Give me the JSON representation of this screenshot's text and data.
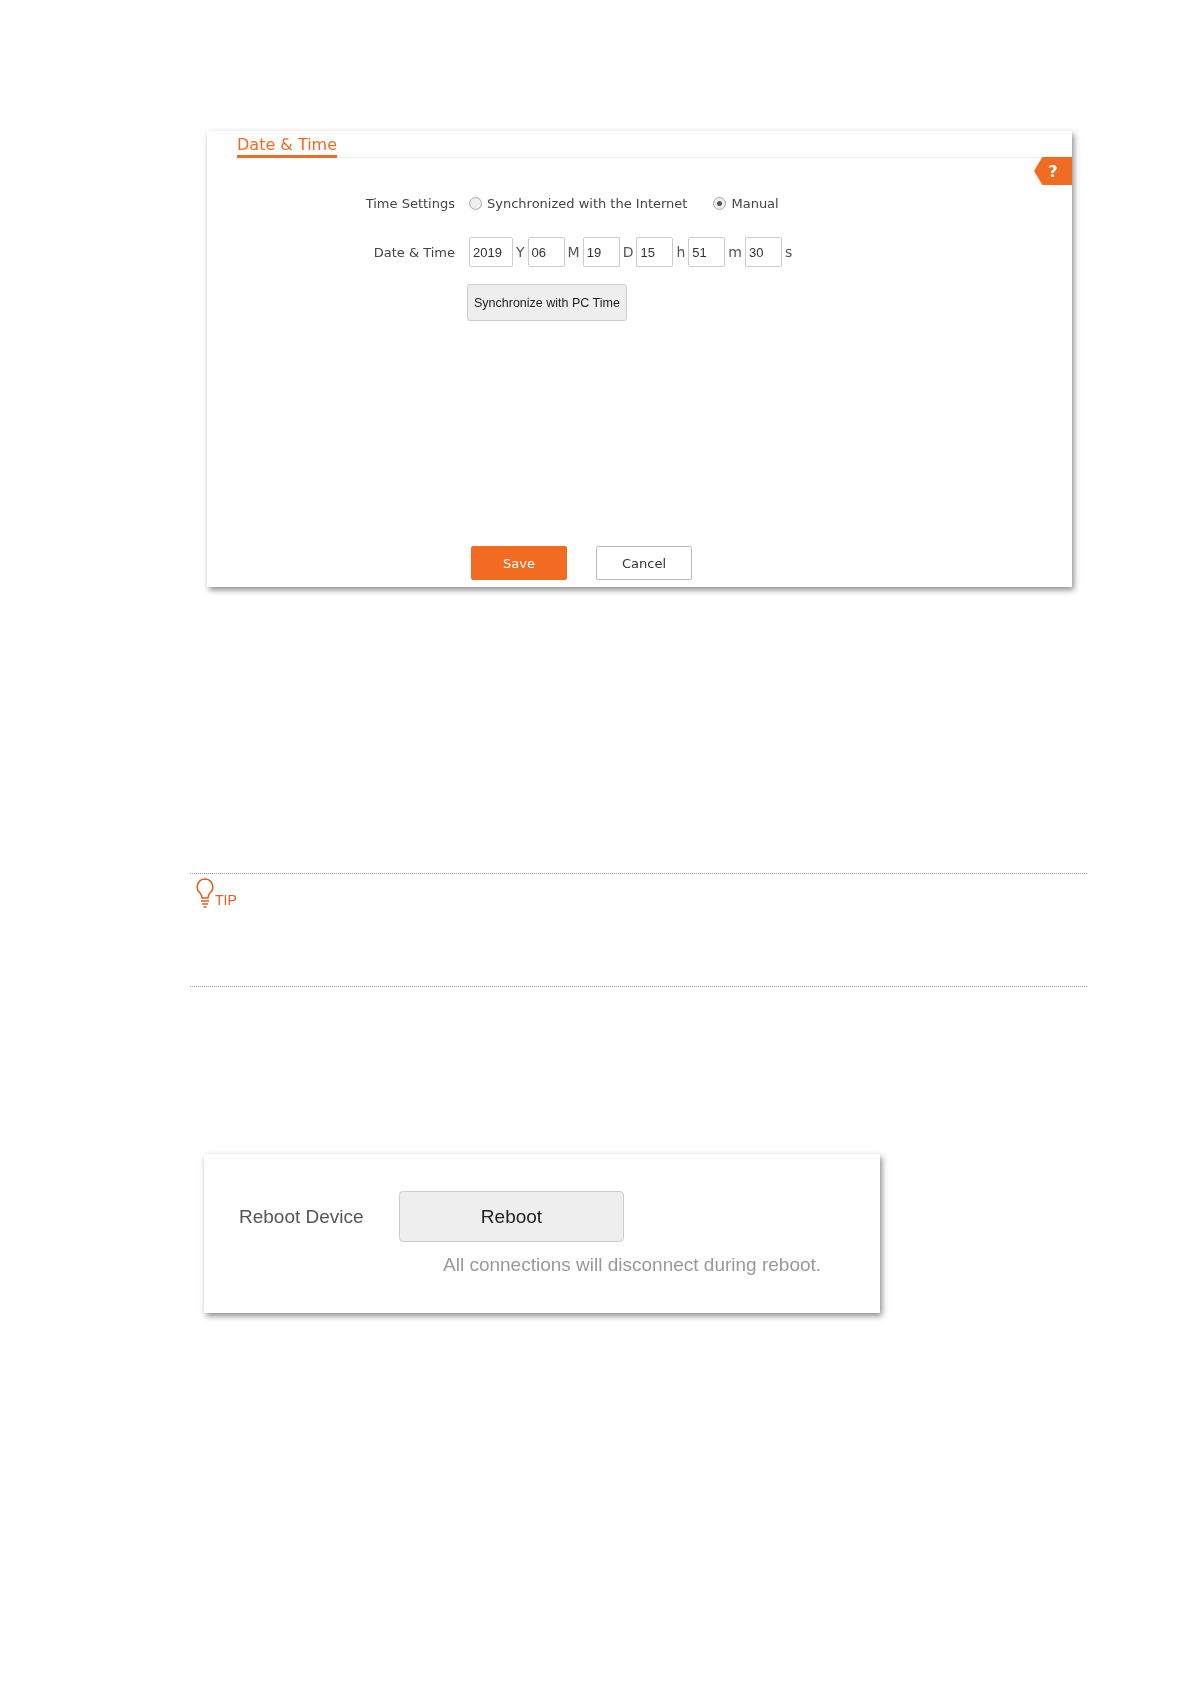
{
  "date_time_panel": {
    "title": "Date & Time",
    "help": "?",
    "time_settings": {
      "label": "Time Settings",
      "options": [
        {
          "label": "Synchronized with the Internet",
          "selected": false
        },
        {
          "label": "Manual",
          "selected": true
        }
      ]
    },
    "date_time": {
      "label": "Date & Time",
      "fields": [
        {
          "value": "2019",
          "unit": "Y"
        },
        {
          "value": "06",
          "unit": "M"
        },
        {
          "value": "19",
          "unit": "D"
        },
        {
          "value": "15",
          "unit": "h"
        },
        {
          "value": "51",
          "unit": "m"
        },
        {
          "value": "30",
          "unit": "s"
        }
      ]
    },
    "sync_button": "Synchronize with PC Time",
    "buttons": [
      {
        "label": "Save",
        "kind": "primary"
      },
      {
        "label": "Cancel",
        "kind": "secondary"
      }
    ]
  },
  "tip": {
    "label": "TIP"
  },
  "reboot_panel": {
    "label": "Reboot Device",
    "button": "Reboot",
    "note": "All connections will disconnect during reboot."
  }
}
